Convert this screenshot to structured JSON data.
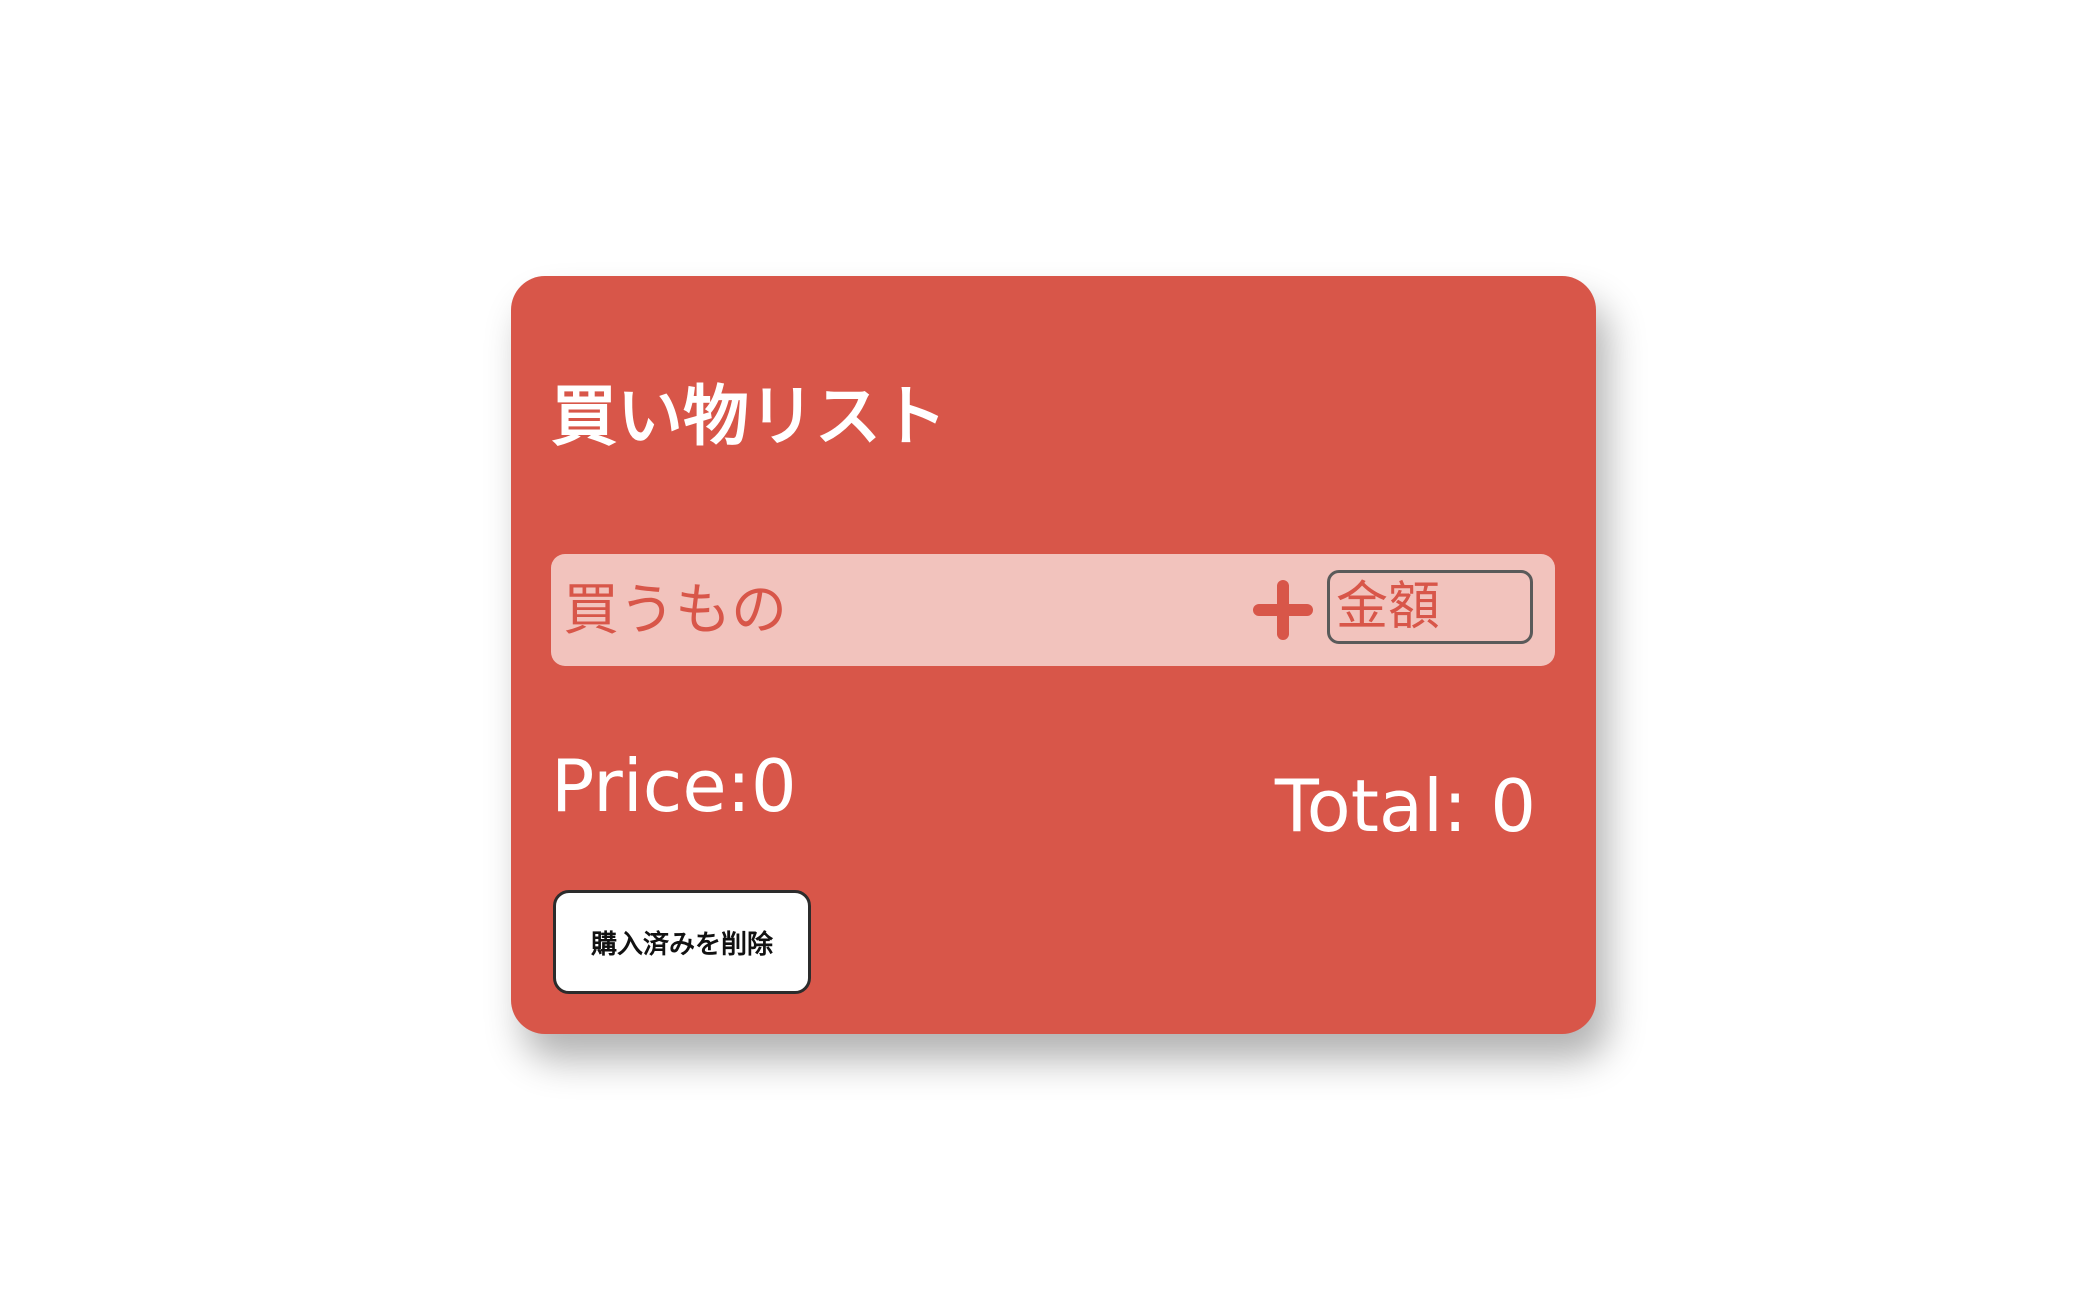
{
  "app": {
    "title": "買い物リスト"
  },
  "form": {
    "item_placeholder": "買うもの",
    "item_value": "",
    "add_icon": "plus-icon",
    "price_placeholder": "金額",
    "price_value": ""
  },
  "summary": {
    "price_text": "Price:0",
    "total_text": "Total: 0"
  },
  "actions": {
    "delete_purchased_label": "購入済みを削除"
  },
  "colors": {
    "background": "#ffffff",
    "card": "#d85649",
    "input_row": "#f2c3bd",
    "accent_text": "#d85649",
    "primary_text": "#ffffff"
  }
}
